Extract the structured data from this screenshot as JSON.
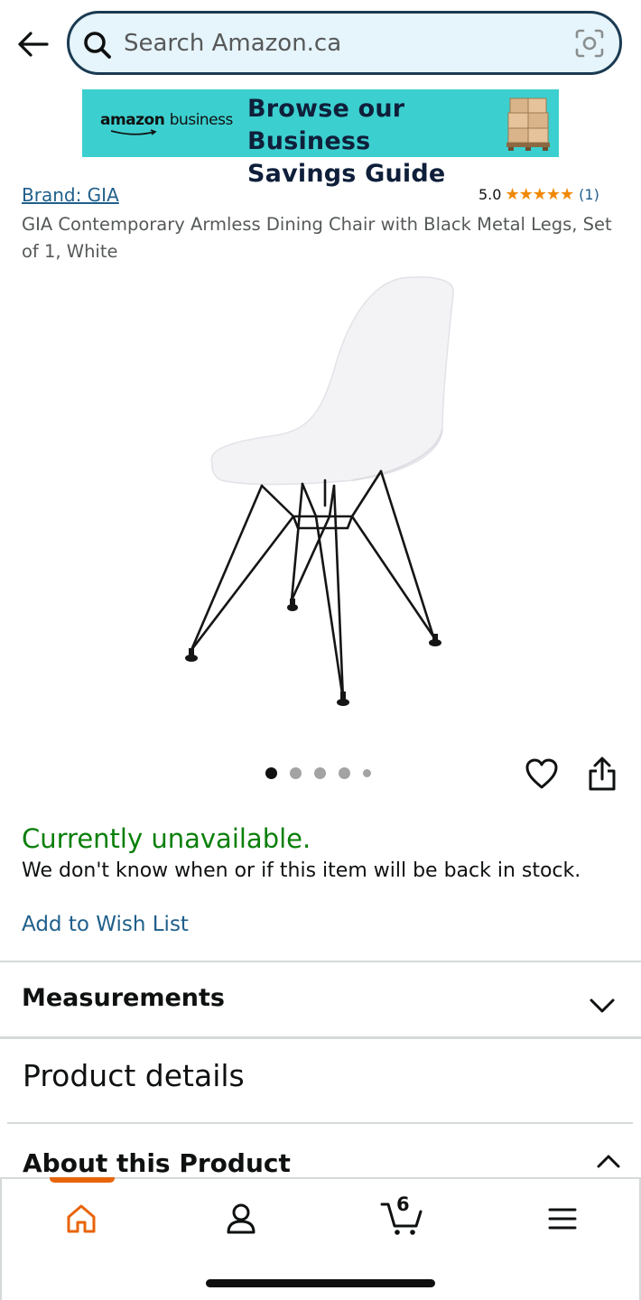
{
  "search": {
    "placeholder": "Search Amazon.ca"
  },
  "banner": {
    "logo_word1": "amazon",
    "logo_word2": "business",
    "headline_line1": "Browse our Business",
    "headline_line2": "Savings Guide",
    "background_color": "#3ccfcf"
  },
  "product": {
    "brand": "Brand: GIA",
    "rating_score": "5.0",
    "stars": "★★★★★",
    "rating_count": "(1)",
    "title": "GIA Contemporary Armless Dining Chair with Black Metal Legs, Set of 1, White",
    "image_icon": "chair-image",
    "carousel_total": 5,
    "carousel_active": 1
  },
  "availability": {
    "status": "Currently unavailable.",
    "detail": "We don't know when or if this item will be back in stock.",
    "status_color": "#0a7f0a"
  },
  "actions": {
    "add_to_wish_list": "Add to Wish List",
    "wish_icon": "heart-icon",
    "share_icon": "share-icon"
  },
  "sections": {
    "measurements": "Measurements",
    "product_details": "Product details",
    "about": "About this Product"
  },
  "bottom_nav": {
    "items": [
      "home-icon",
      "account-icon",
      "cart-icon",
      "menu-icon"
    ],
    "active": "home",
    "cart_count": "6",
    "accent_color": "#e8640a"
  }
}
